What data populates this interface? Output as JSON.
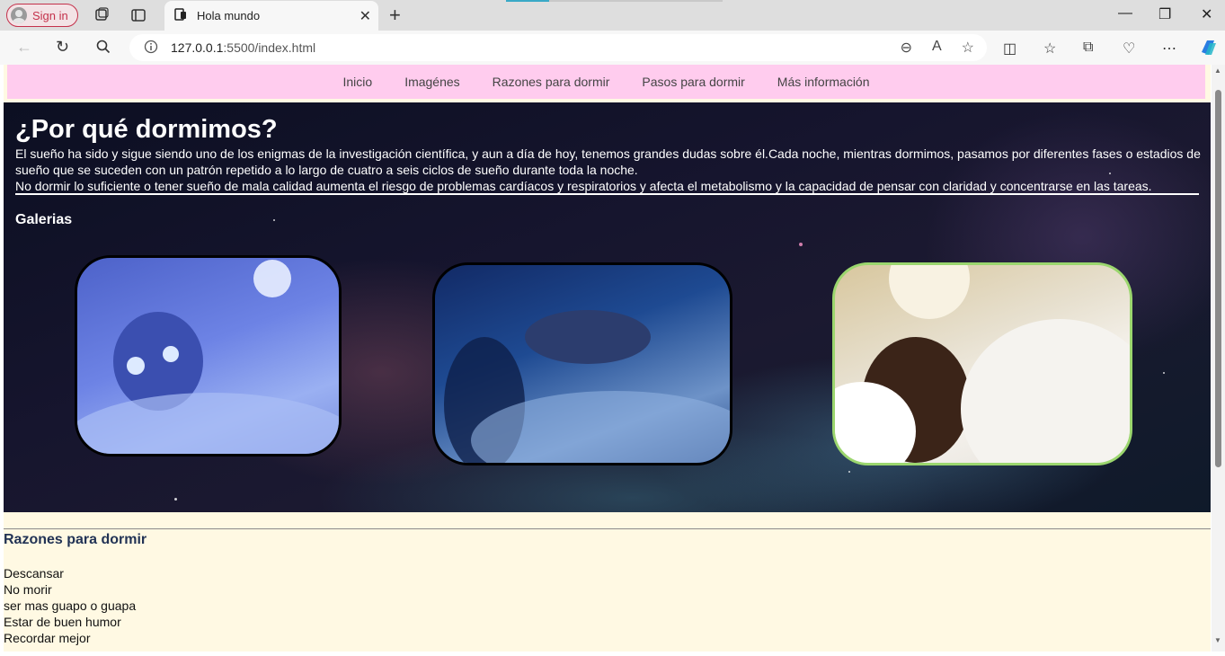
{
  "browser": {
    "signin_label": "Sign in",
    "tab_title": "Hola mundo",
    "url_host": "127.0.0.1",
    "url_rest": ":5500/index.html"
  },
  "nav": {
    "items": [
      "Inicio",
      "Imagénes",
      "Razones para dormir",
      "Pasos para dormir",
      "Más información"
    ]
  },
  "hero": {
    "title": "¿Por qué dormimos?",
    "intro_1": "El sueño ha sido y sigue siendo uno de los enigmas de la investigación científica, y aun a día de hoy, tenemos grandes dudas sobre él.Cada noche, mientras dormimos, pasamos por diferentes fases o estadios de sueño que se suceden con un patrón repetido a lo largo de cuatro a seis ciclos de sueño durante toda la noche.",
    "intro_2": "No dormir lo suficiente o tener sueño de mala calidad aumenta el riesgo de problemas cardíacos y respiratorios y afecta el metabolismo y la capacidad de pensar con claridad y concentrarse en las tareas.",
    "gallery_title": "Galerias"
  },
  "reasons": {
    "title": "Razones para dormir",
    "items": [
      "Descansar",
      "No morir",
      "ser mas guapo o guapa",
      "Estar de buen humor",
      "Recordar mejor"
    ]
  },
  "colors": {
    "nav_bg": "#ffccee",
    "page_bg": "#fff9e3",
    "reasons_title": "#223355"
  }
}
